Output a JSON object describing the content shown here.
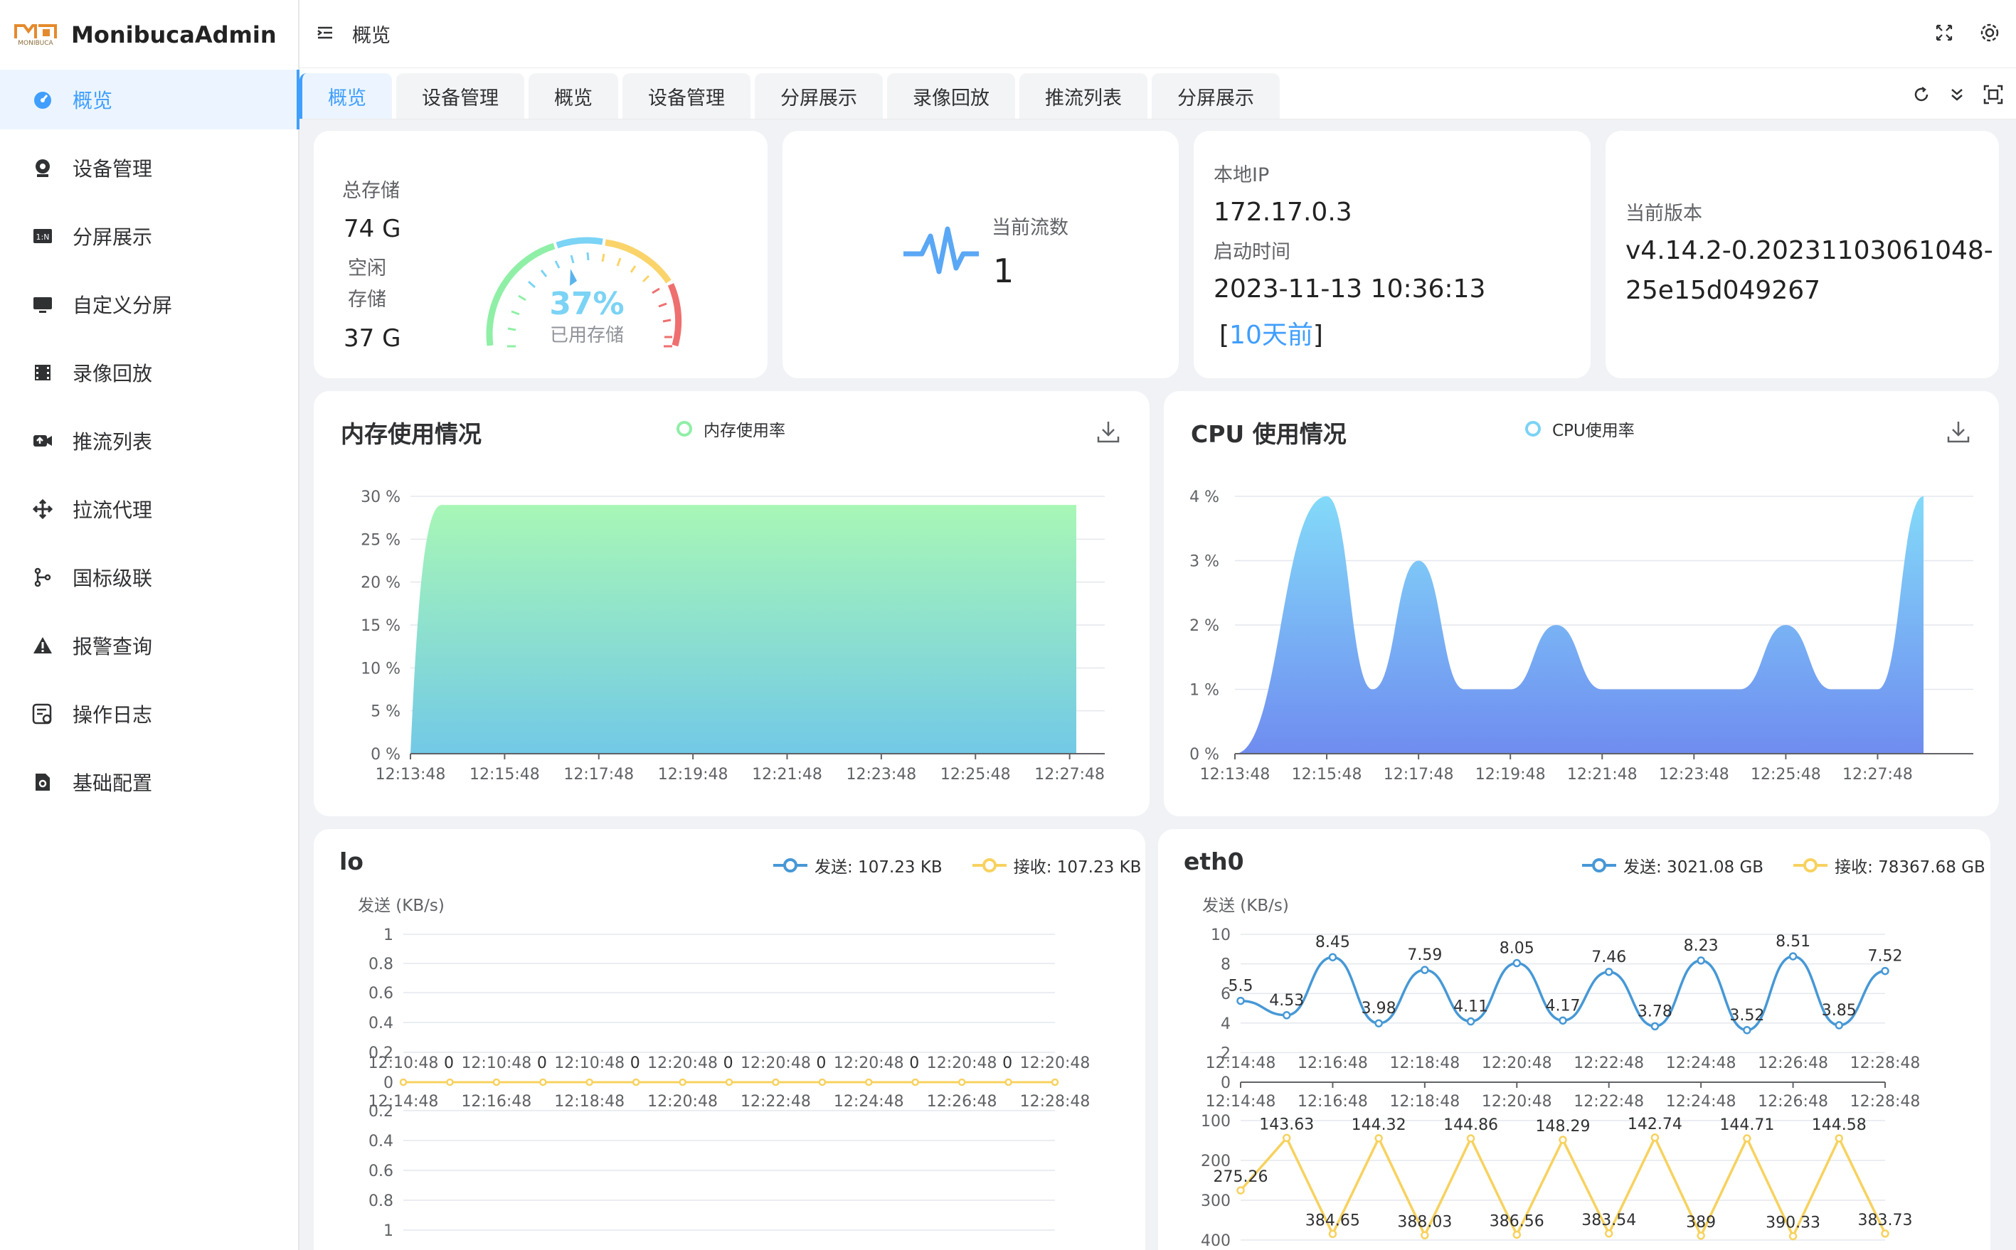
{
  "app": {
    "title": "MonibucaAdmin",
    "logo_caption": "MONIBUCA"
  },
  "sidebar": {
    "items": [
      {
        "label": "概览",
        "icon": "dashboard-icon",
        "active": true
      },
      {
        "label": "设备管理",
        "icon": "camera-icon"
      },
      {
        "label": "分屏展示",
        "icon": "split-screen-icon"
      },
      {
        "label": "自定义分屏",
        "icon": "monitor-icon"
      },
      {
        "label": "录像回放",
        "icon": "film-icon"
      },
      {
        "label": "推流列表",
        "icon": "video-push-icon"
      },
      {
        "label": "拉流代理",
        "icon": "arrows-icon"
      },
      {
        "label": "国标级联",
        "icon": "branch-icon"
      },
      {
        "label": "报警查询",
        "icon": "warning-icon"
      },
      {
        "label": "操作日志",
        "icon": "log-icon"
      },
      {
        "label": "基础配置",
        "icon": "settings-file-icon"
      }
    ]
  },
  "header": {
    "breadcrumb": "概览",
    "icons": [
      "menu-fold-icon",
      "fullscreen-icon",
      "settings-icon"
    ]
  },
  "tabs": {
    "items": [
      {
        "label": "概览",
        "active": true
      },
      {
        "label": "设备管理"
      },
      {
        "label": "概览"
      },
      {
        "label": "设备管理"
      },
      {
        "label": "分屏展示"
      },
      {
        "label": "录像回放"
      },
      {
        "label": "推流列表"
      },
      {
        "label": "分屏展示"
      }
    ],
    "icons": [
      "refresh-icon",
      "collapse-icon",
      "maximize-icon"
    ]
  },
  "storage": {
    "total_label": "总存储",
    "total_value": "74 G",
    "free_label": "空闲存储",
    "free_value": "37 G",
    "used_percent": 37,
    "used_percent_text": "37%",
    "used_label": "已用存储"
  },
  "streams": {
    "label": "当前流数",
    "value": "1"
  },
  "server": {
    "ip_label": "本地IP",
    "ip": "172.17.0.3",
    "start_label": "启动时间",
    "start_time": "2023-11-13 10:36:13",
    "ago_open": "[",
    "ago": "10天前",
    "ago_close": "]"
  },
  "version": {
    "label": "当前版本",
    "value_line1": "v4.14.2-0.20231103061048-",
    "value_line2": "25e15d049267"
  },
  "memory": {
    "title": "内存使用情况",
    "legend": "内存使用率",
    "download_icon": "download-icon"
  },
  "cpu": {
    "title": "CPU 使用情况",
    "legend": "CPU使用率",
    "download_icon": "download-icon"
  },
  "lo": {
    "title": "lo",
    "legend_send": "发送: 107.23 KB",
    "legend_recv": "接收: 107.23 KB",
    "unit": "发送 (KB/s)"
  },
  "eth0": {
    "title": "eth0",
    "legend_send": "发送: 3021.08 GB",
    "legend_recv": "接收: 78367.68 GB",
    "unit": "发送 (KB/s)"
  },
  "chart_data": [
    {
      "type": "area",
      "title": "内存使用情况",
      "series": [
        {
          "name": "内存使用率",
          "values": [
            0,
            29,
            29,
            29,
            29,
            29,
            29,
            29,
            29
          ]
        }
      ],
      "x": [
        "12:13:48",
        "12:15:48",
        "12:17:48",
        "12:19:48",
        "12:21:48",
        "12:23:48",
        "12:25:48",
        "12:27:48"
      ],
      "yticks": [
        "0 %",
        "5 %",
        "10 %",
        "15 %",
        "20 %",
        "25 %",
        "30 %"
      ],
      "ylim": [
        0,
        30
      ],
      "color": "#7ee3a2"
    },
    {
      "type": "area",
      "title": "CPU 使用情况",
      "series": [
        {
          "name": "CPU使用率",
          "values": [
            0,
            4,
            1,
            3,
            1,
            1,
            2,
            1,
            1,
            1,
            1,
            2,
            1,
            1,
            4
          ]
        }
      ],
      "x": [
        "12:13:48",
        "12:15:48",
        "12:17:48",
        "12:19:48",
        "12:21:48",
        "12:23:48",
        "12:25:48",
        "12:27:48"
      ],
      "yticks": [
        "0 %",
        "1 %",
        "2 %",
        "3 %",
        "4 %"
      ],
      "ylim": [
        0,
        4
      ],
      "color": "#5aa7f5"
    },
    {
      "type": "line",
      "title": "lo",
      "x": [
        "12:14:48",
        "12:16:48",
        "12:18:48",
        "12:20:48",
        "12:22:48",
        "12:24:48",
        "12:26:48",
        "12:28:48"
      ],
      "x_top": [
        "12:10:48",
        "12:10:48",
        "12:10:48",
        "12:20:48",
        "12:20:48",
        "12:20:48",
        "12:20:48",
        "12:20:48"
      ],
      "series": [
        {
          "name": "发送",
          "values": [
            0,
            0,
            0,
            0,
            0,
            0,
            0,
            0,
            0,
            0,
            0,
            0,
            0,
            0,
            0
          ]
        },
        {
          "name": "接收",
          "values": [
            0,
            0,
            0,
            0,
            0,
            0,
            0,
            0,
            0,
            0,
            0,
            0,
            0,
            0,
            0
          ]
        }
      ],
      "point_labels": [
        "0",
        "0",
        "0",
        "0",
        "0",
        "0",
        "0"
      ],
      "yticks_top": [
        "1",
        "0.8",
        "0.6",
        "0.4",
        "0.2",
        "0"
      ],
      "yticks_bottom": [
        "0.2",
        "0.4",
        "0.6",
        "0.8",
        "1"
      ]
    },
    {
      "type": "line",
      "title": "eth0",
      "x": [
        "12:14:48",
        "12:16:48",
        "12:18:48",
        "12:20:48",
        "12:22:48",
        "12:24:48",
        "12:26:48",
        "12:28:48"
      ],
      "series": [
        {
          "name": "发送",
          "values": [
            5.5,
            4.53,
            8.45,
            3.98,
            7.59,
            4.11,
            8.05,
            4.17,
            7.46,
            3.78,
            8.23,
            3.52,
            8.51,
            3.85,
            7.52
          ]
        },
        {
          "name": "接收",
          "values": [
            275.26,
            143.63,
            384.65,
            144.32,
            388.03,
            144.86,
            386.56,
            148.29,
            383.54,
            142.74,
            389,
            144.71,
            390.33,
            144.58,
            383.73
          ]
        }
      ],
      "yticks_top": [
        "10",
        "8",
        "6",
        "4",
        "2",
        "0"
      ],
      "yticks_bottom": [
        "100",
        "200",
        "300",
        "400"
      ]
    }
  ]
}
